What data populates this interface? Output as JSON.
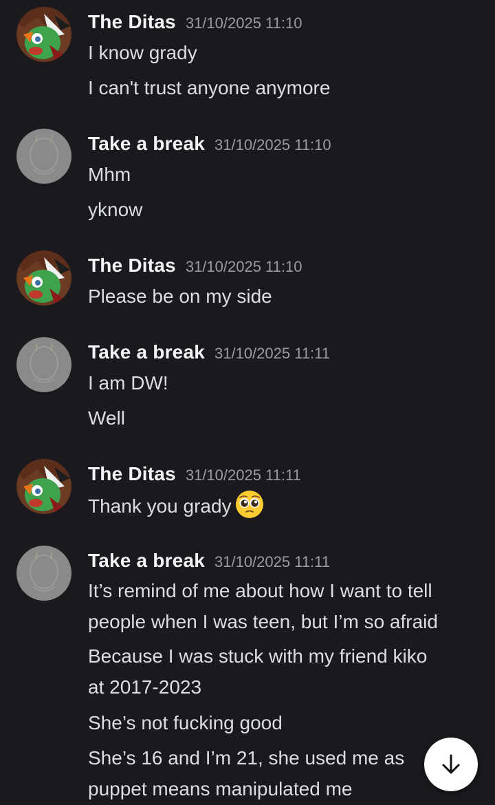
{
  "messages": [
    {
      "author": "The Ditas",
      "avatar": "ditas-avatar",
      "time": "31/10/2025 11:10",
      "lines": [
        "I know grady",
        "I can't trust anyone anymore"
      ]
    },
    {
      "author": "Take a break",
      "avatar": "grey-avatar",
      "time": "31/10/2025 11:10",
      "lines": [
        "Mhm",
        "yknow"
      ]
    },
    {
      "author": "The Ditas",
      "avatar": "ditas-avatar",
      "time": "31/10/2025 11:10",
      "lines": [
        "Please be on my side"
      ]
    },
    {
      "author": "Take a break",
      "avatar": "grey-avatar",
      "time": "31/10/2025 11:11",
      "lines": [
        "I am DW!",
        "Well"
      ]
    },
    {
      "author": "The Ditas",
      "avatar": "ditas-avatar",
      "time": "31/10/2025 11:11",
      "lines": [
        "Thank you grady"
      ],
      "emoji": "pleading-face-emoji"
    },
    {
      "author": "Take a break",
      "avatar": "grey-avatar",
      "time": "31/10/2025 11:11",
      "lines": [
        "It’s remind of me about how I want to tell",
        "people when I was teen, but I’m so afraid",
        "Because I was stuck with my friend kiko",
        "at 2017-2023",
        "She’s not fucking good",
        "She’s 16 and I’m 21, she used me as",
        "puppet means manipulated me"
      ]
    }
  ],
  "scroll_button": {
    "icon": "arrow-down-icon"
  },
  "colors": {
    "background": "#1a1a1e",
    "username": "#f2f3f5",
    "timestamp": "#9a9ca3",
    "message_text": "#dbdee1"
  }
}
